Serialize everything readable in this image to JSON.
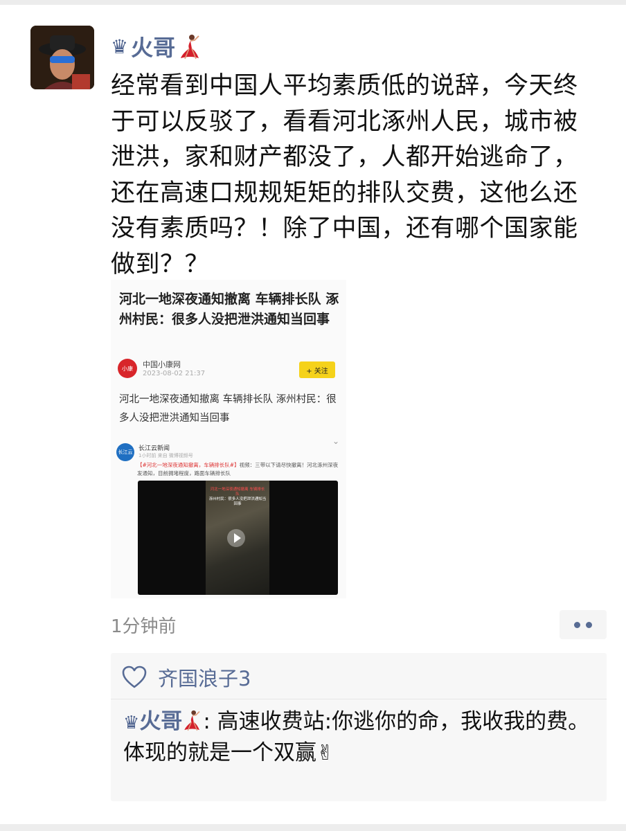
{
  "post": {
    "username": "火哥",
    "crown_glyph": "♛",
    "text": "经常看到中国人平均素质低的说辞，今天终于可以反驳了，看看河北涿州人民，城市被泄洪，家和财产都没了，人都开始逃命了，还在高速口规规矩矩的排队交费，这他么还没有素质吗？！除了中国，还有哪个国家能做到？？",
    "timestamp": "1分钟前"
  },
  "article": {
    "title": "河北一地深夜通知撤离 车辆排长队 涿州村民：很多人没把泄洪通知当回事",
    "source_logo": "小康",
    "source_name": "中国小康网",
    "source_time": "2023-08-02 21:37",
    "follow_label": "+ 关注",
    "subtitle": "河北一地深夜通知撤离 车辆排长队 涿州村民：很多人没把泄洪通知当回事",
    "embedded_logo": "长江云",
    "embedded_name": "长江云新闻",
    "embedded_meta": "1小时前 来自 微博视频号",
    "embedded_text_red": "【#河北一地深夜通知撤离，车辆排长队#】",
    "embedded_text": "视频：三带以下请尽快撤离！河北涿州深夜发通知，目前拥堵程度，路面车辆排长队",
    "video_caption_top": "河北一地深夜通知撤离 车辆排长队",
    "video_caption_bottom": "涿州村民：很多人没把泄洪通知当回事"
  },
  "comments": {
    "liked_by": "齐国浪子3",
    "items": [
      {
        "user": "火哥",
        "separator": ": ",
        "line1": "高速收费站:你逃你的命，我收我的费。",
        "line2": "体现的就是一个双赢",
        "emoji": "✌"
      }
    ]
  },
  "colors": {
    "link_blue": "#576b95",
    "comment_bg": "#f7f7f7",
    "follow_yellow": "#f5d21a"
  },
  "icons": [
    "crown-icon",
    "dancer-icon",
    "heart-icon",
    "more-dots-icon",
    "play-icon",
    "victory-hand-icon"
  ]
}
